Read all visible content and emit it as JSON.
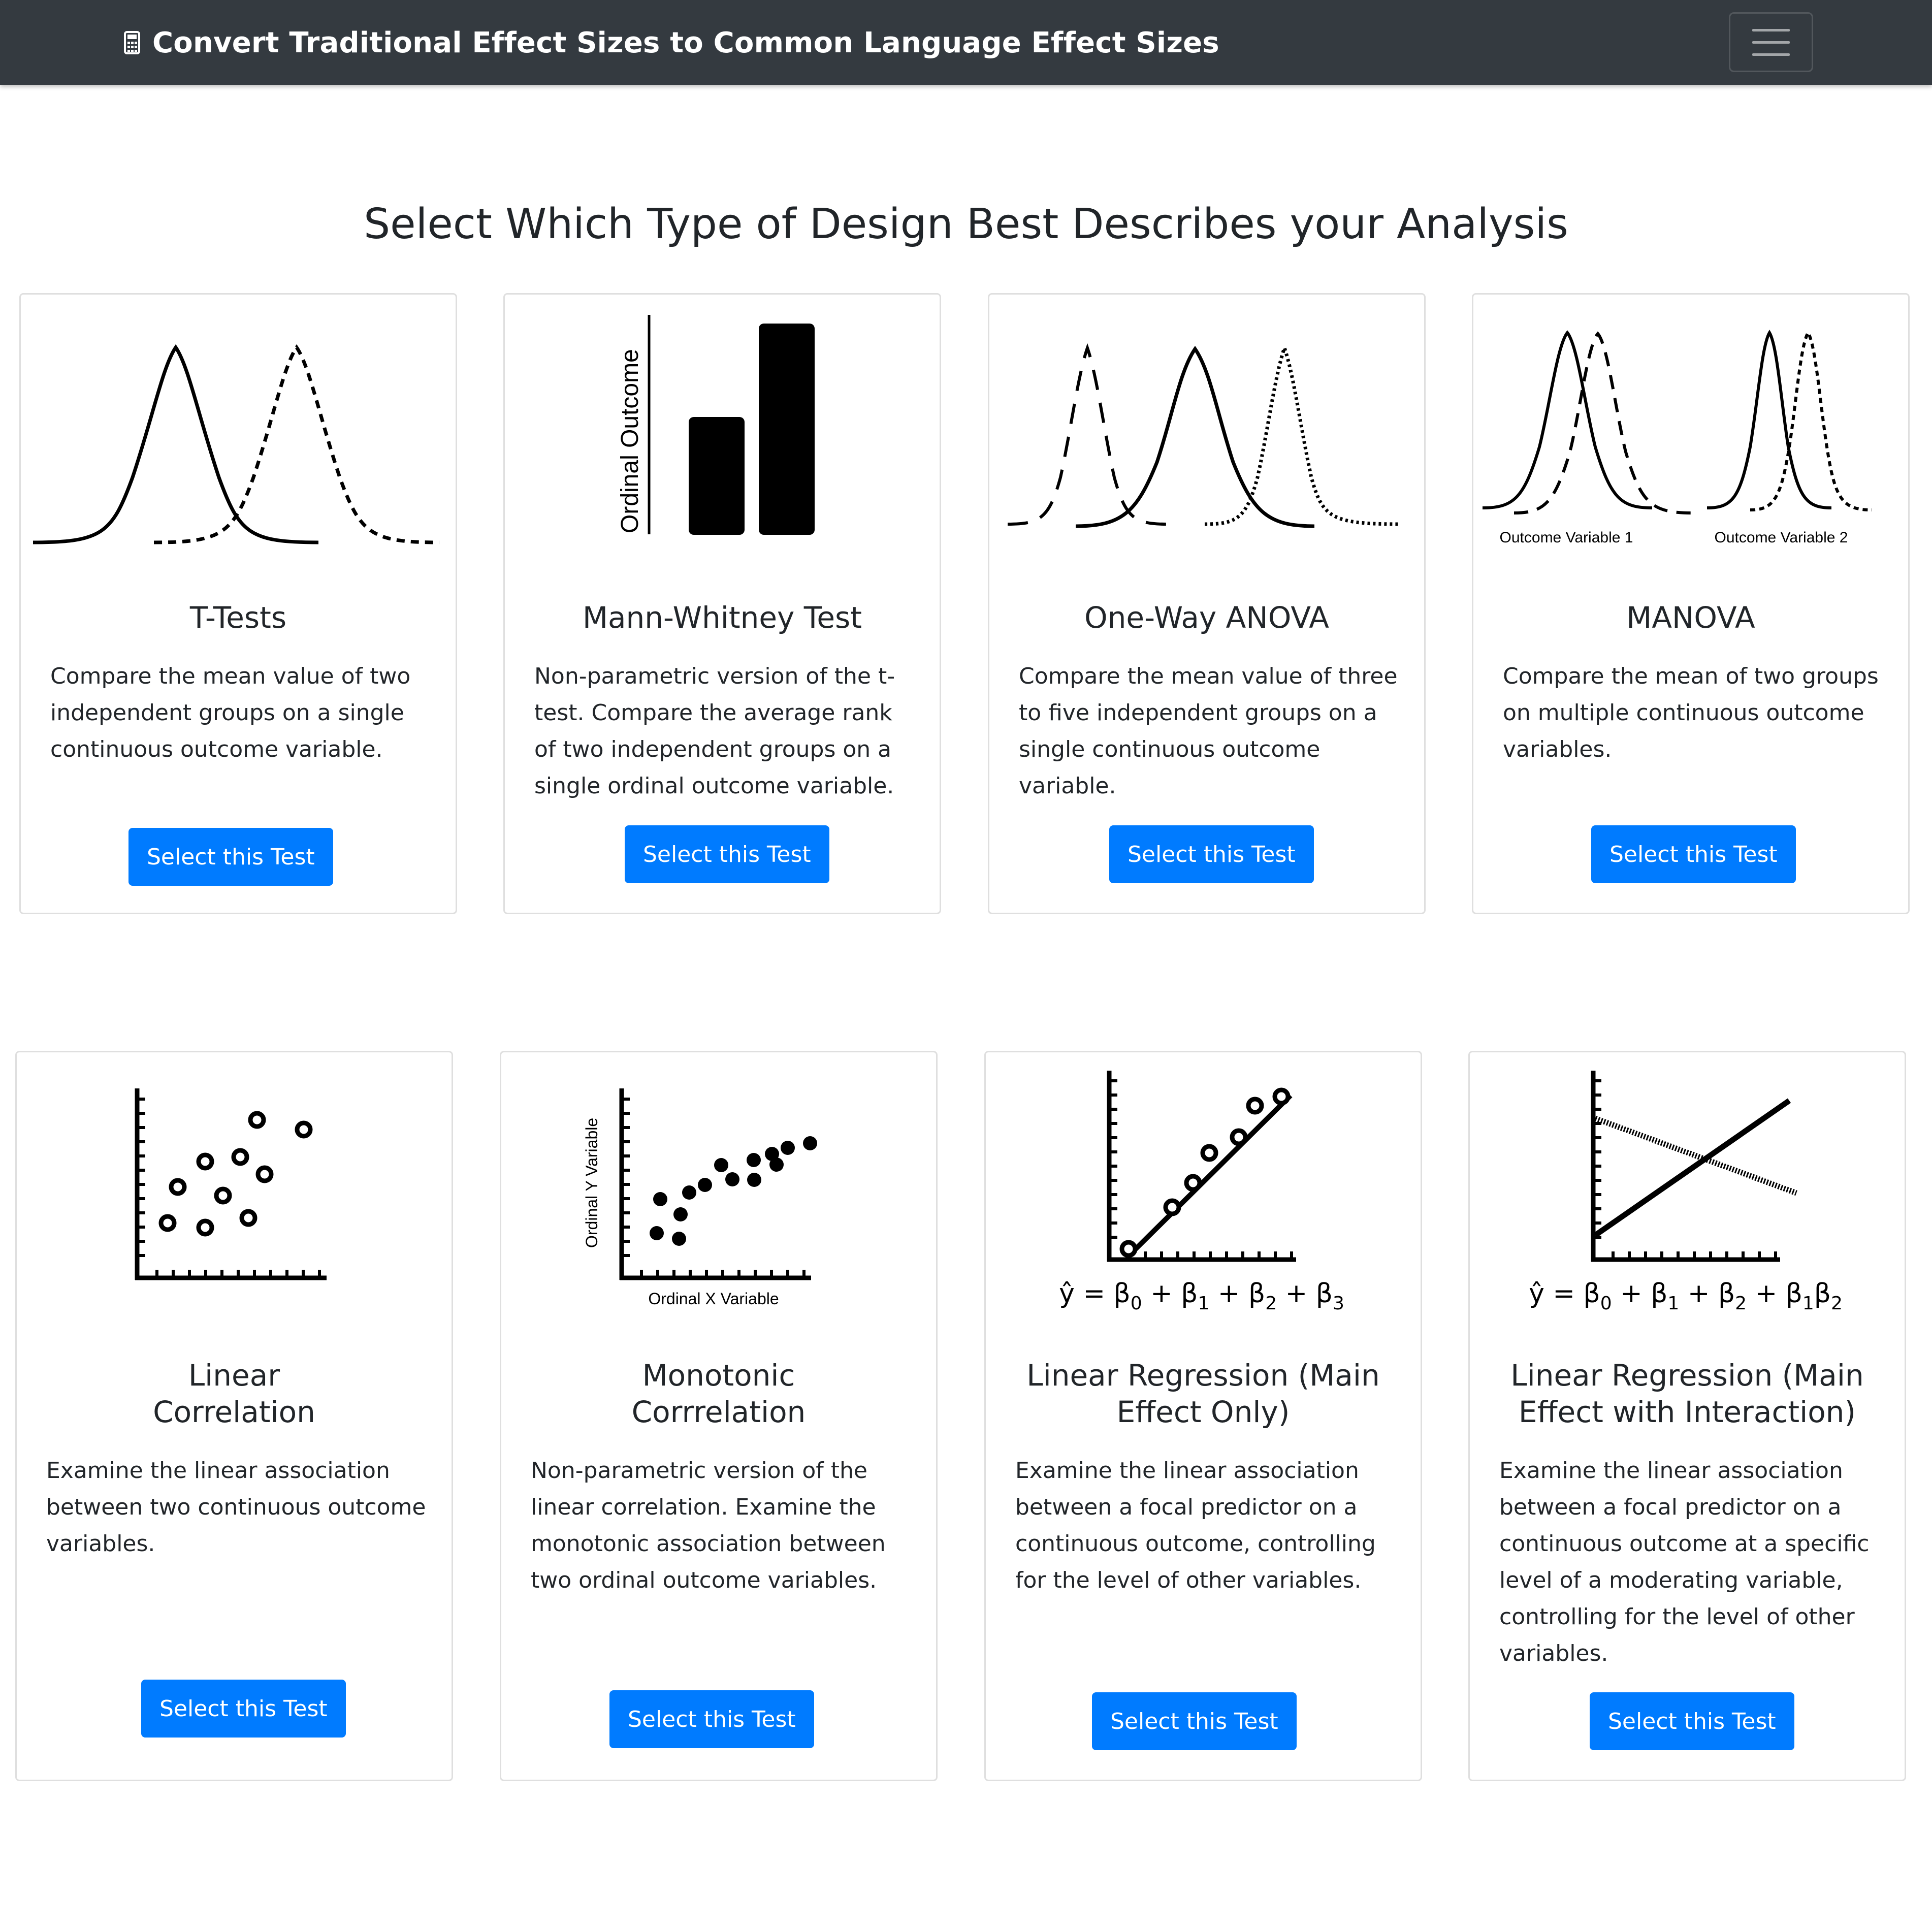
{
  "navbar": {
    "brand_title": "Convert Traditional Effect Sizes to Common Language Effect Sizes",
    "brand_icon": "calculator-icon",
    "toggler_icon": "hamburger-menu-icon",
    "background_color": "#343a40"
  },
  "page": {
    "heading": "Select Which Type of Design Best Describes your Analysis"
  },
  "colors": {
    "button": "#007bff",
    "button_text": "#ffffff",
    "text": "#212529",
    "card_border": "#dfdfdf"
  },
  "cards": [
    {
      "title": "T-Tests",
      "description": "Compare the mean value of two independent groups on a single continuous outcome variable.",
      "button_label": "Select this Test",
      "illustration": "two-overlapping-normal-curves"
    },
    {
      "title": "Mann-Whitney Test",
      "description": "Non-parametric version of the t-test. Compare the average rank of two independent groups on a single ordinal outcome variable.",
      "button_label": "Select this Test",
      "illustration": "two-bars-ordinal",
      "axis_label": "Ordinal Outcome"
    },
    {
      "title": "One-Way ANOVA",
      "description": "Compare the mean value of three to five independent groups on a single continuous outcome variable.",
      "button_label": "Select this Test",
      "illustration": "three-normal-curves"
    },
    {
      "title": "MANOVA",
      "description": "Compare the mean of two groups on multiple continuous outcome variables.",
      "button_label": "Select this Test",
      "illustration": "two-pairs-of-normal-curves",
      "labels": [
        "Outcome Variable 1",
        "Outcome Variable 2"
      ]
    },
    {
      "title": "Linear Correlation",
      "description": "Examine the linear association between two continuous outcome variables.",
      "button_label": "Select this Test",
      "illustration": "scatter-plot-open-circles"
    },
    {
      "title": "Monotonic Corrrelation",
      "description": "Non-parametric version of the linear correlation. Examine the monotonic association between two ordinal outcome variables.",
      "button_label": "Select this Test",
      "illustration": "scatter-plot-filled-dots",
      "x_label": "Ordinal X Variable",
      "y_label": "Ordinal Y Variable"
    },
    {
      "title": "Linear Regression (Main Effect Only)",
      "description": "Examine the linear association between a focal predictor on a continuous outcome, controlling for the level of other variables.",
      "button_label": "Select this Test",
      "illustration": "regression-line-with-points",
      "equation": "ŷ = β0 + β1 + β2 + β3"
    },
    {
      "title": "Linear Regression (Main Effect with Interaction)",
      "description": "Examine the linear association between a focal predictor on a continuous outcome at a specific level of a moderating variable, controlling for the level of other variables.",
      "button_label": "Select this Test",
      "illustration": "crossing-regression-lines",
      "equation": "ŷ = β0 + β1 + β2 + β1β2"
    }
  ]
}
